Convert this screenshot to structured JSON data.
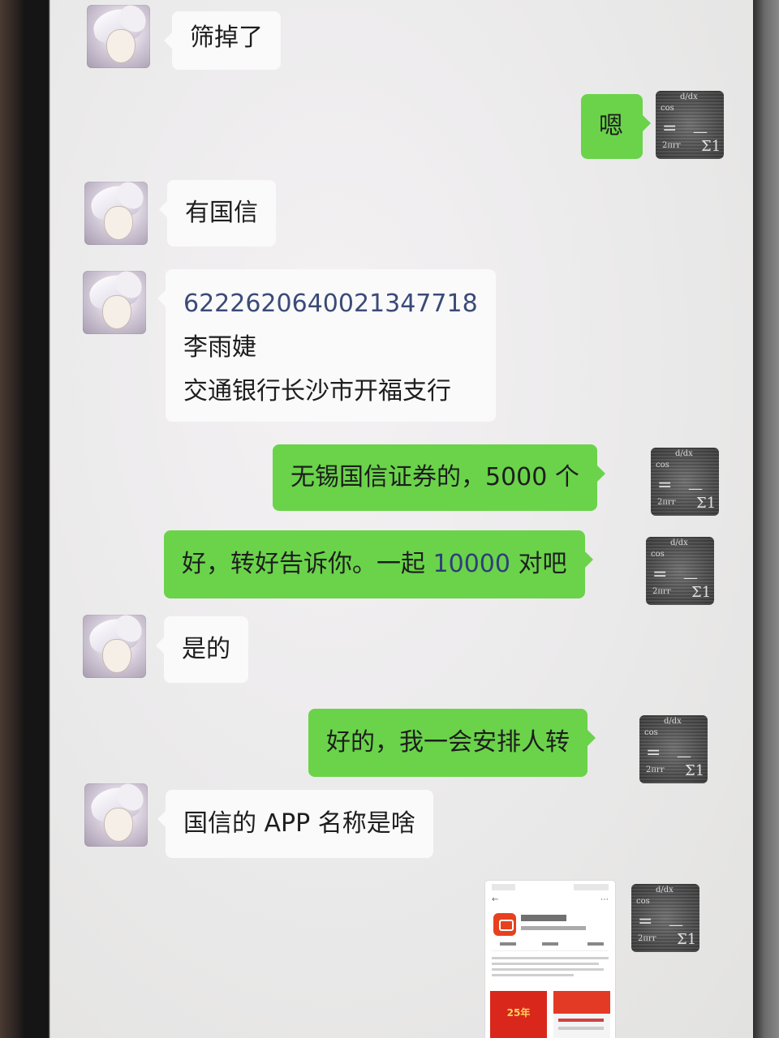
{
  "messages": [
    {
      "side": "in",
      "text": "筛掉了"
    },
    {
      "side": "out",
      "text": "嗯"
    },
    {
      "side": "in",
      "text": "有国信"
    },
    {
      "side": "in",
      "lines": [
        "6222620640021347718",
        "李雨婕",
        "交通银行长沙市开福支行"
      ]
    },
    {
      "side": "out",
      "text": "无锡国信证券的，5000 个"
    },
    {
      "side": "out",
      "text_parts": [
        "好，转好告诉你。一起 ",
        "10000",
        " 对吧"
      ]
    },
    {
      "side": "in",
      "text": "是的"
    },
    {
      "side": "out",
      "text": "好的，我一会安排人转"
    },
    {
      "side": "in",
      "text": "国信的 APP 名称是啥"
    },
    {
      "side": "out",
      "type": "image",
      "image_caption": "25年"
    }
  ],
  "colors": {
    "incoming_bubble": "#fafafa",
    "outgoing_bubble": "#6ad34a",
    "chat_background": "#ecebec",
    "account_number_text": "#3b4a78"
  },
  "icons": {
    "contact_avatar": "anime-avatar-icon",
    "self_avatar": "math-formula-avatar-icon",
    "app_icon_in_screenshot": "app-icon"
  }
}
